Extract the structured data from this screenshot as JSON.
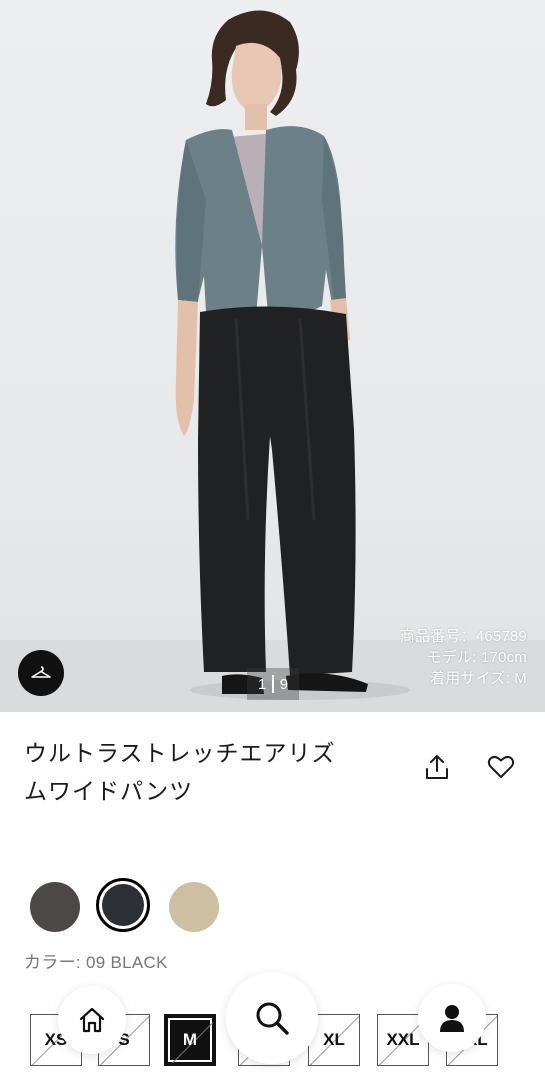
{
  "hero": {
    "product_number": "商品番号：465789",
    "model_height": "モデル: 170cm",
    "model_size": "着用サイズ: M",
    "pager_current": "1",
    "pager_total": "9",
    "hanger_icon": "hanger-icon"
  },
  "product": {
    "title_line1": "ウルトラストレッチエアリズ",
    "title_line2": "ムワイドパンツ",
    "share_icon": "share-icon",
    "favorite_icon": "heart-icon"
  },
  "colors": {
    "label": "カラー: 09 BLACK",
    "swatches": [
      {
        "hex": "#4b4847",
        "selected": false
      },
      {
        "hex": "#2c3034",
        "selected": true
      },
      {
        "hex": "#cdbfa2",
        "selected": false
      }
    ]
  },
  "sizes": {
    "items": [
      "XS",
      "S",
      "M",
      "L",
      "XL",
      "XXL",
      "3XL"
    ],
    "selected": "M"
  },
  "nav": {
    "home_icon": "home-icon",
    "search_icon": "search-icon",
    "account_icon": "person-icon"
  }
}
